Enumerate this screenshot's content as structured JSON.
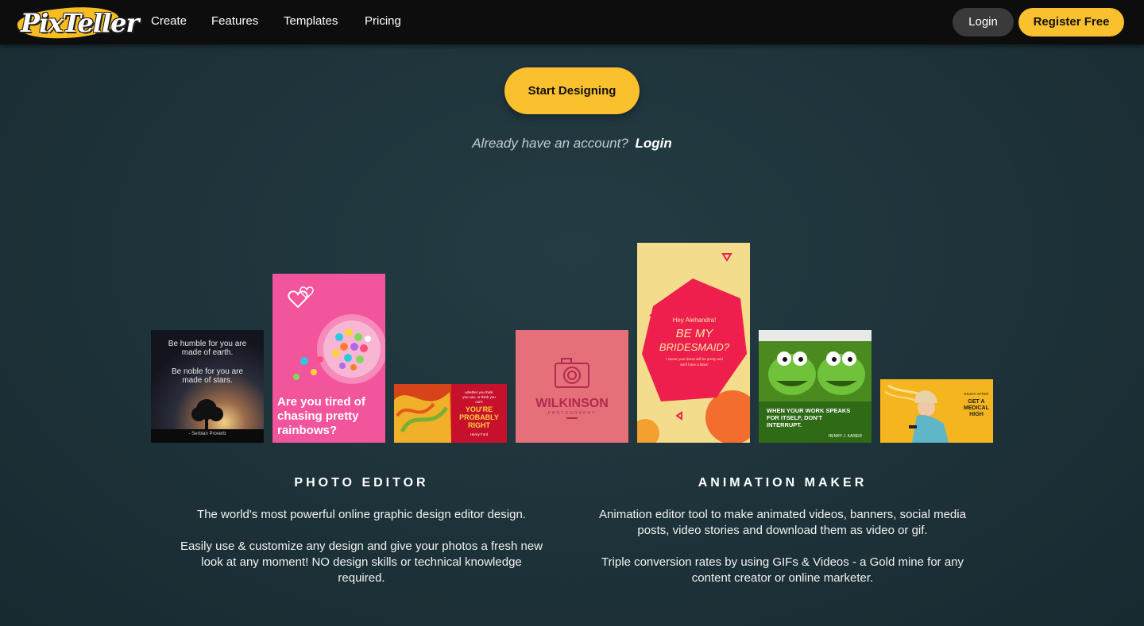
{
  "header": {
    "logo_text": "PixTeller",
    "nav": [
      "Create",
      "Features",
      "Templates",
      "Pricing"
    ],
    "login_label": "Login",
    "register_label": "Register Free"
  },
  "hero": {
    "start_label": "Start Designing",
    "already_text": "Already have an account?",
    "login_link": "Login"
  },
  "cards": {
    "card1": {
      "lines": [
        "Be humble for you are",
        "made of earth.",
        "Be noble for you are",
        "made of stars."
      ],
      "credit": "- Serbian Proverb"
    },
    "card2": {
      "lines": [
        "Are you tired of",
        "chasing pretty",
        "rainbows?"
      ]
    },
    "card3": {
      "small": [
        "whether you think",
        "you can, or think you",
        "can't"
      ],
      "big": [
        "YOU'RE",
        "PROBABLY",
        "RIGHT"
      ],
      "credit": "Henry Ford"
    },
    "card4": {
      "brand": "WILKINSON",
      "sub": "PHOTOGRAPHY"
    },
    "card5": {
      "greeting": "Hey Alehandra!",
      "big": [
        "BE MY",
        "BRIDESMAID?"
      ],
      "small": [
        "I swear your dress will be pretty and",
        "we'll have a blast!"
      ]
    },
    "card6": {
      "lines": [
        "WHEN YOUR WORK SPEAKS",
        "FOR ITSELF, DON'T",
        "INTERRUPT."
      ],
      "credit": "HENRY J. KAISER"
    },
    "card7": {
      "lines": [
        "ENJOY AFTER",
        "GET A",
        "MEDICAL",
        "HIGH"
      ]
    }
  },
  "sections": {
    "photo": {
      "title": "PHOTO EDITOR",
      "p1": "The world's most powerful online graphic design editor design.",
      "p2_l1": "Easily use & customize any design and give your photos a fresh new",
      "p2_l2": "look at any moment! NO design skills or technical knowledge",
      "p2_l3": "required."
    },
    "animation": {
      "title": "ANIMATION MAKER",
      "p1_l1": "Animation editor tool to make animated videos, banners, social media",
      "p1_l2": "posts, video stories and download them as video or gif.",
      "p2_l1": "Triple conversion rates by using GIFs & Videos - a Gold mine for any",
      "p2_l2": "content creator or online marketer."
    }
  },
  "colors": {
    "accent": "#fbc02d",
    "topbar": "#0d0d0d",
    "background": "#1e3339"
  }
}
